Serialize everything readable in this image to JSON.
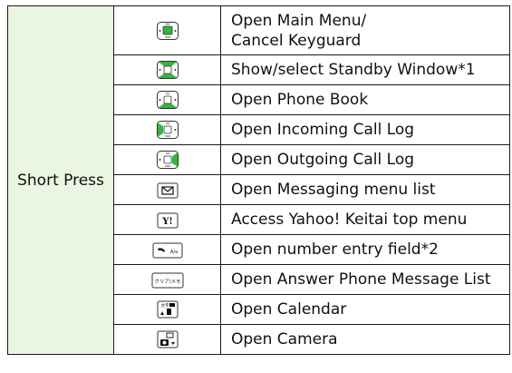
{
  "table": {
    "group_label": "Short Press",
    "rows": [
      {
        "icon": "center-key-icon",
        "text1": "Open Main Menu/",
        "text2": "Cancel Keyguard"
      },
      {
        "icon": "up-down-key-icon",
        "text1": "Show/select Standby Window*1"
      },
      {
        "icon": "down-key-icon",
        "text1": "Open Phone Book"
      },
      {
        "icon": "left-key-icon",
        "text1": "Open Incoming Call Log"
      },
      {
        "icon": "right-key-icon",
        "text1": "Open Outgoing Call Log"
      },
      {
        "icon": "mail-key-icon",
        "text1": "Open Messaging menu list"
      },
      {
        "icon": "yahoo-key-icon",
        "text1": "Access Yahoo! Keitai top menu"
      },
      {
        "icon": "send-key-icon",
        "text1": "Open number entry field*2"
      },
      {
        "icon": "clear-key-icon",
        "text1": "Open Answer Phone Message List"
      },
      {
        "icon": "calendar-key-icon",
        "text1": "Open Calendar"
      },
      {
        "icon": "camera-key-icon",
        "text1": "Open Camera"
      }
    ],
    "icon_glyphs": {
      "yahoo": "Y!",
      "send_sub": "A/a",
      "clear": "クリア/メモ",
      "calendar_sub": "文字"
    },
    "colors": {
      "group_bg": "#eaf5e2",
      "key_highlight": "#35b540",
      "border": "#1a1a1a"
    }
  }
}
